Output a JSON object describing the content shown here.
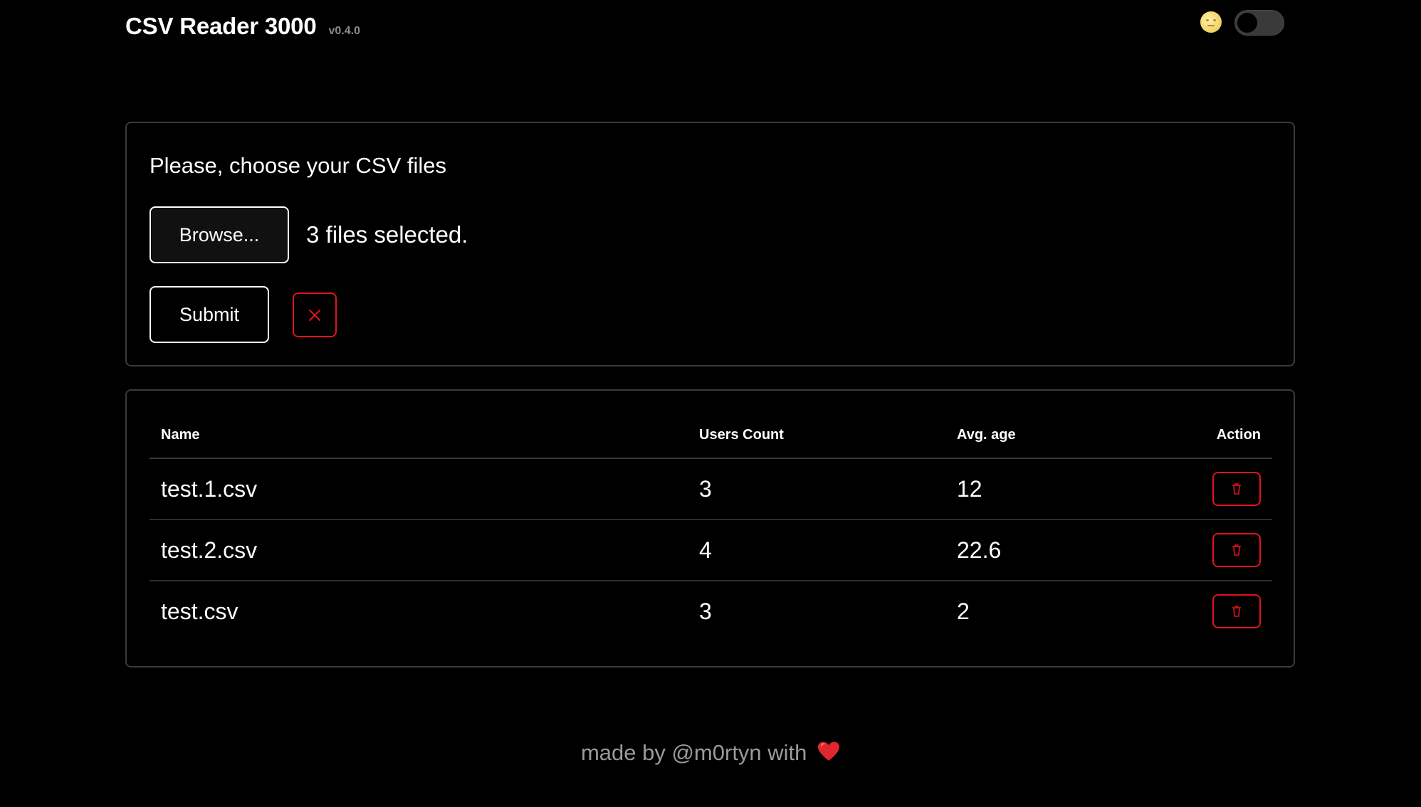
{
  "header": {
    "title": "CSV Reader 3000",
    "version": "v0.4.0",
    "theme_icon": "moon-face-icon",
    "theme_toggle": {
      "checked": false
    }
  },
  "upload": {
    "prompt": "Please, choose your CSV files",
    "browse_label": "Browse...",
    "files_status": "3 files selected.",
    "submit_label": "Submit",
    "clear_icon": "close-icon"
  },
  "table": {
    "columns": [
      "Name",
      "Users Count",
      "Avg. age",
      "Action"
    ],
    "rows": [
      {
        "name": "test.1.csv",
        "users_count": "3",
        "avg_age": "12",
        "action_icon": "trash-icon"
      },
      {
        "name": "test.2.csv",
        "users_count": "4",
        "avg_age": "22.6",
        "action_icon": "trash-icon"
      },
      {
        "name": "test.csv",
        "users_count": "3",
        "avg_age": "2",
        "action_icon": "trash-icon"
      }
    ]
  },
  "footer": {
    "text": "made by @m0rtyn with",
    "heart_icon": "heart-icon"
  },
  "colors": {
    "background": "#000000",
    "text": "#ffffff",
    "border": "#3a3a3a",
    "danger": "#e0141c",
    "muted": "#9a9a9a"
  }
}
